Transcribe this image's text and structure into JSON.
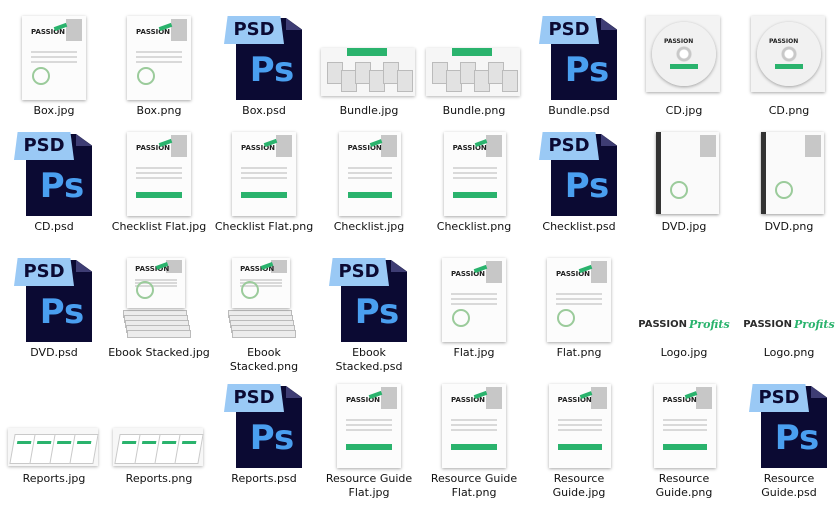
{
  "files": [
    {
      "name": "Box.jpg",
      "kind": "box"
    },
    {
      "name": "Box.png",
      "kind": "box"
    },
    {
      "name": "Box.psd",
      "kind": "psd"
    },
    {
      "name": "Bundle.jpg",
      "kind": "bundle"
    },
    {
      "name": "Bundle.png",
      "kind": "bundle"
    },
    {
      "name": "Bundle.psd",
      "kind": "psd"
    },
    {
      "name": "CD.jpg",
      "kind": "cd"
    },
    {
      "name": "CD.png",
      "kind": "cd"
    },
    {
      "name": "CD.psd",
      "kind": "psd"
    },
    {
      "name": "Checklist Flat.jpg",
      "kind": "flatdoc"
    },
    {
      "name": "Checklist Flat.png",
      "kind": "flatdoc"
    },
    {
      "name": "Checklist.jpg",
      "kind": "doc3d"
    },
    {
      "name": "Checklist.png",
      "kind": "doc3d"
    },
    {
      "name": "Checklist.psd",
      "kind": "psd"
    },
    {
      "name": "DVD.jpg",
      "kind": "dvd"
    },
    {
      "name": "DVD.png",
      "kind": "dvd"
    },
    {
      "name": "DVD.psd",
      "kind": "psd"
    },
    {
      "name": "Ebook Stacked.jpg",
      "kind": "stack"
    },
    {
      "name": "Ebook Stacked.png",
      "kind": "stack"
    },
    {
      "name": "Ebook Stacked.psd",
      "kind": "psd"
    },
    {
      "name": "Flat.jpg",
      "kind": "flat"
    },
    {
      "name": "Flat.png",
      "kind": "flat"
    },
    {
      "name": "Logo.jpg",
      "kind": "logo"
    },
    {
      "name": "Logo.png",
      "kind": "logo"
    },
    {
      "name": "Reports.jpg",
      "kind": "reports"
    },
    {
      "name": "Reports.png",
      "kind": "reports"
    },
    {
      "name": "Reports.psd",
      "kind": "psd"
    },
    {
      "name": "Resource Guide Flat.jpg",
      "kind": "flatdoc"
    },
    {
      "name": "Resource Guide Flat.png",
      "kind": "flatdoc"
    },
    {
      "name": "Resource Guide.jpg",
      "kind": "doc3d"
    },
    {
      "name": "Resource Guide.png",
      "kind": "doc3d"
    },
    {
      "name": "Resource Guide.psd",
      "kind": "psd"
    }
  ],
  "icons": {
    "psd_tag": "PSD",
    "ps_mark": "Ps",
    "logo_word_a": "PASSION",
    "logo_word_b": "Profits"
  },
  "colors": {
    "psd_page": "#0b0a33",
    "psd_text": "#4a9ff0",
    "psd_tag": "#9ac9f5",
    "brand_green": "#2ab36d"
  }
}
